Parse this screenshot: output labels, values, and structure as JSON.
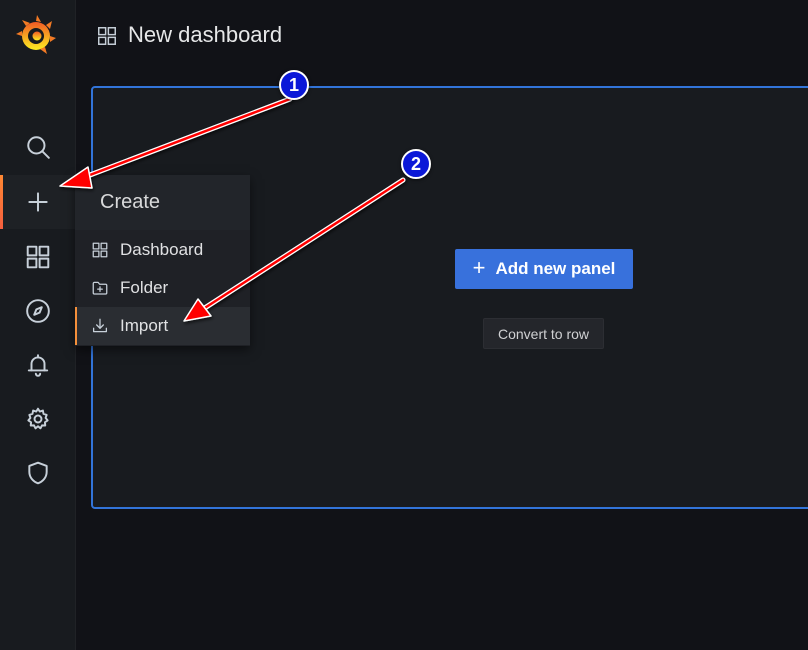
{
  "header": {
    "title": "New dashboard"
  },
  "sidebar": {
    "items": [
      {
        "name": "search-icon"
      },
      {
        "name": "plus-icon",
        "active": true
      },
      {
        "name": "dashboards-icon"
      },
      {
        "name": "compass-icon"
      },
      {
        "name": "bell-icon"
      },
      {
        "name": "gear-icon"
      },
      {
        "name": "shield-icon"
      }
    ]
  },
  "create_menu": {
    "header": "Create",
    "items": [
      {
        "label": "Dashboard",
        "icon": "grid-icon"
      },
      {
        "label": "Folder",
        "icon": "folder-plus-icon"
      },
      {
        "label": "Import",
        "icon": "import-icon",
        "active": true
      }
    ]
  },
  "panel": {
    "add_button_label": "Add new panel",
    "convert_button_label": "Convert to row"
  },
  "annotations": {
    "callout_1": "1",
    "callout_2": "2"
  },
  "colors": {
    "accent_blue": "#3871dc",
    "panel_border": "#3274d9",
    "active_orange": "#f5903b",
    "annotation_arrow": "#ff0000",
    "callout_blue": "#0b18d8"
  }
}
